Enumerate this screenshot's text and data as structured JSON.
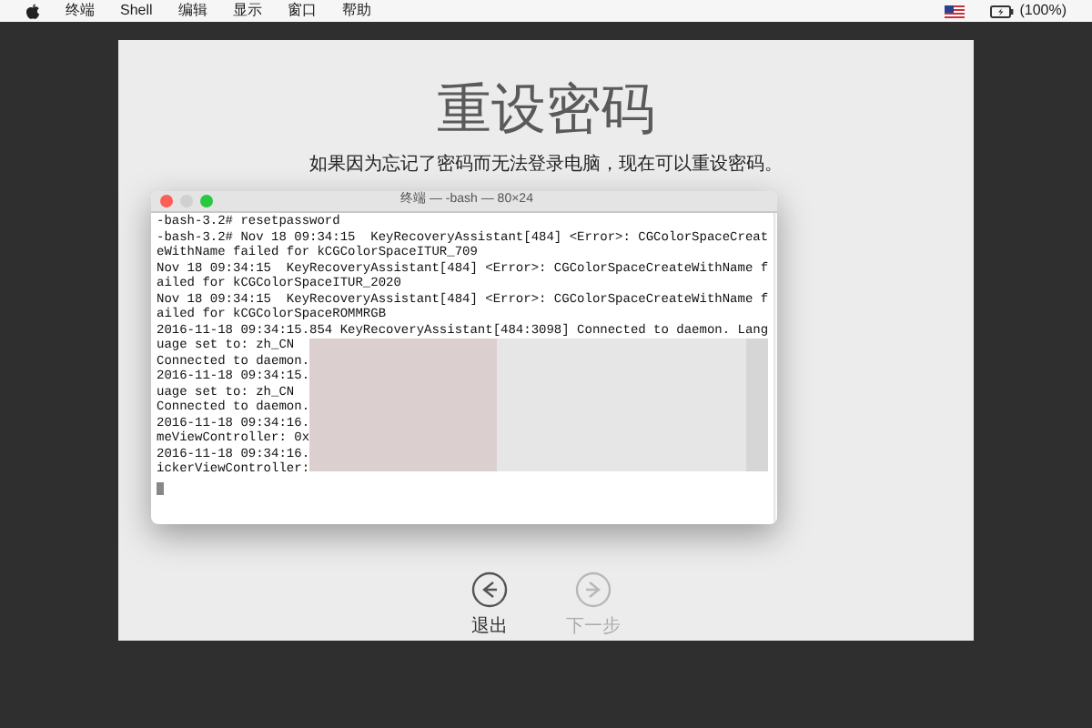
{
  "menu_bar": {
    "items": [
      "终端",
      "Shell",
      "编辑",
      "显示",
      "窗口",
      "帮助"
    ],
    "battery": "(100%)"
  },
  "title": "重设密码",
  "subtitle": "如果因为忘记了密码而无法登录电脑，现在可以重设密码。",
  "terminal": {
    "title": "终端 — -bash — 80×24",
    "lines": [
      "-bash-3.2# resetpassword",
      "-bash-3.2# Nov 18 09:34:15  KeyRecoveryAssistant[484] <Error>: CGColorSpaceCreat",
      "eWithName failed for kCGColorSpaceITUR_709",
      "Nov 18 09:34:15  KeyRecoveryAssistant[484] <Error>: CGColorSpaceCreateWithName f",
      "ailed for kCGColorSpaceITUR_2020",
      "Nov 18 09:34:15  KeyRecoveryAssistant[484] <Error>: CGColorSpaceCreateWithName f",
      "ailed for kCGColorSpaceROMMRGB",
      "2016-11-18 09:34:15.854 KeyRecoveryAssistant[484:3098] Connected to daemon. Lang",
      "uage set to: zh_CN",
      "Connected to daemon.",
      "2016-11-18 09:34:15.",
      "uage set to: zh_CN",
      "Connected to daemon.",
      "2016-11-18 09:34:16.",
      "meViewController: 0x",
      "2016-11-18 09:34:16.",
      "ickerViewController:"
    ]
  },
  "nav_buttons": [
    {
      "label": "退出",
      "kind": "back",
      "disabled": false
    },
    {
      "label": "下一步",
      "kind": "next",
      "disabled": true
    }
  ]
}
